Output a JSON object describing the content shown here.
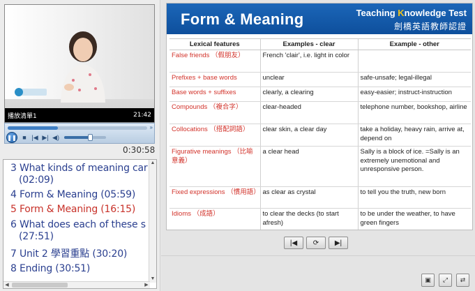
{
  "video": {
    "caption_left": "播放清單1",
    "caption_right": "21:42",
    "progress": 0.36,
    "volume": 0.6,
    "total_time": "0:30:58"
  },
  "chapters": [
    {
      "line1": "3 What kinds of meaning car",
      "line2": "(02:09)",
      "active": false
    },
    {
      "line1": "4 Form & Meaning (05:59)",
      "active": false
    },
    {
      "line1": "5 Form & Meaning (16:15)",
      "active": true
    },
    {
      "line1": "6 What does each of these s",
      "line2": "(27:51)",
      "active": false
    },
    {
      "line1": "7 Unit 2 學習重點 (30:20)",
      "active": false
    },
    {
      "line1": "8 Ending (30:51)",
      "active": false
    }
  ],
  "slide": {
    "title": "Form & Meaning",
    "tkt_pre": "Teaching ",
    "tkt_k": "K",
    "tkt_post": "nowledge Test",
    "tkt_cn": "劍橋英語教師認證",
    "headers": [
      "Lexical features",
      "Examples - clear",
      "Example - other"
    ],
    "rows": [
      {
        "feature": "False friends （假朋友）",
        "clear": "French 'clair', i.e. light in color",
        "other": ""
      },
      {
        "feature": "Prefixes + base words",
        "clear": "unclear",
        "other": "safe-unsafe; legal-illegal"
      },
      {
        "feature": "Base words + suffixes",
        "clear": "clearly, a clearing",
        "other": "easy-easier; instruct-instruction"
      },
      {
        "feature": "Compounds （複合字）",
        "clear": "clear-headed",
        "other": "telephone number, bookshop, airline"
      },
      {
        "feature": "Collocations （搭配詞語）",
        "clear": "clear skin, a clear day",
        "other": "take a holiday, heavy rain, arrive at, depend on"
      },
      {
        "feature": "Figurative meanings （比喻意義）",
        "clear": "a clear head",
        "other": "Sally is a block of ice. =Sally is an extremely unemotional and unresponsive person."
      },
      {
        "feature": "Fixed expressions （慣用語）",
        "clear": "as clear as crystal",
        "other": "to tell you the truth, new born"
      },
      {
        "feature": "Idioms （成語）",
        "clear": "to clear the decks (to start afresh)",
        "other": "to be under the weather, to have green fingers"
      }
    ]
  },
  "icons": {
    "play_pause": "pause-icon",
    "stop": "stop-icon",
    "prev": "previous-icon",
    "next": "next-icon",
    "volume": "speaker-icon"
  },
  "colors": {
    "banner": "#1b66b8",
    "feature_text": "#d2322a",
    "chapter_text": "#2a3f8f",
    "chapter_active": "#c8322a"
  }
}
